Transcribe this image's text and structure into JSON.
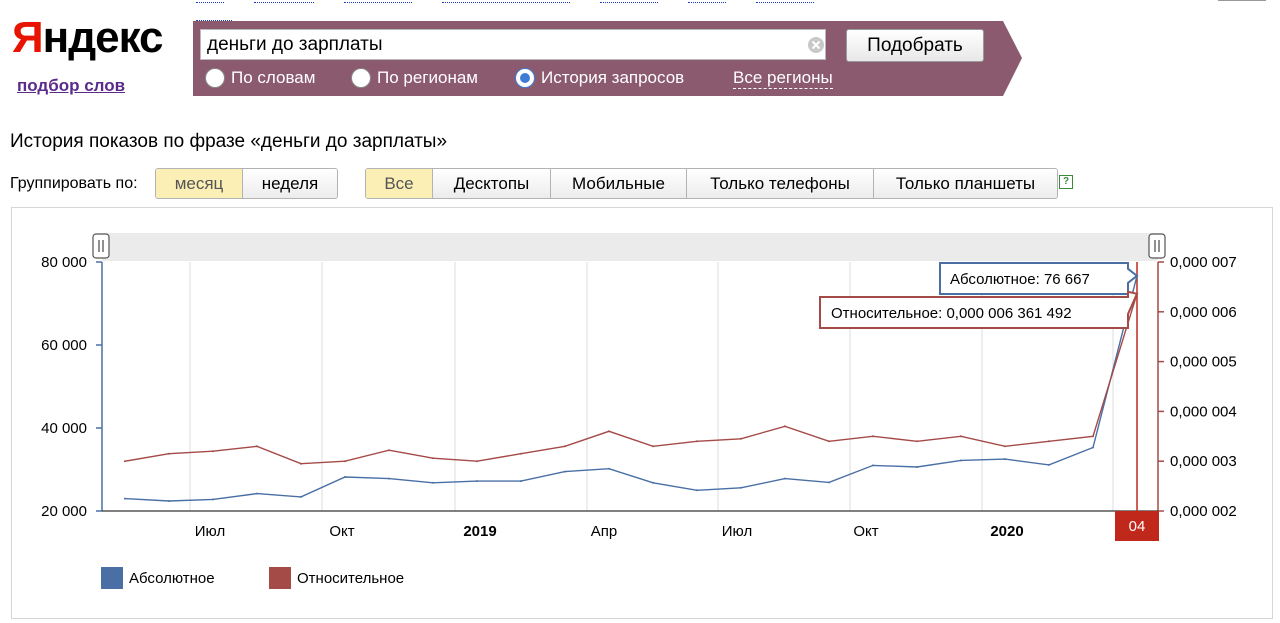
{
  "header": {
    "logo": "Яндекс",
    "logo_first": "Я",
    "logo_rest": "ндекс",
    "subtitle": "подбор слов"
  },
  "search": {
    "query": "деньги до зарплаты",
    "submit_label": "Подобрать",
    "modes": [
      {
        "label": "По словам",
        "selected": false
      },
      {
        "label": "По регионам",
        "selected": false
      },
      {
        "label": "История запросов",
        "selected": true
      }
    ],
    "regions_link": "Все регионы",
    "bar_color": "#8b5a6e"
  },
  "page": {
    "title": "История показов по фразе «деньги до зарплаты»"
  },
  "grouping": {
    "label": "Группировать по:",
    "options": [
      {
        "label": "месяц",
        "active": true
      },
      {
        "label": "неделя",
        "active": false
      }
    ]
  },
  "devices": {
    "options": [
      {
        "label": "Все",
        "active": true
      },
      {
        "label": "Десктопы",
        "active": false
      },
      {
        "label": "Мобильные",
        "active": false
      },
      {
        "label": "Только телефоны",
        "active": false
      },
      {
        "label": "Только планшеты",
        "active": false
      }
    ],
    "help": "?"
  },
  "chart_data": {
    "type": "line",
    "x_ticks": [
      {
        "label": "Июл",
        "bold": false
      },
      {
        "label": "Окт",
        "bold": false
      },
      {
        "label": "2019",
        "bold": true
      },
      {
        "label": "Апр",
        "bold": false
      },
      {
        "label": "Июл",
        "bold": false
      },
      {
        "label": "Окт",
        "bold": false
      },
      {
        "label": "2020",
        "bold": true
      }
    ],
    "y_left": {
      "min": 20000,
      "max": 80000,
      "ticks": [
        "20 000",
        "40 000",
        "60 000",
        "80 000"
      ],
      "tick_values": [
        20000,
        40000,
        60000,
        80000
      ]
    },
    "y_right": {
      "min": 2e-06,
      "max": 7e-06,
      "ticks": [
        "0,000 002",
        "0,000 003",
        "0,000 004",
        "0,000 005",
        "0,000 006",
        "0,000 007"
      ],
      "tick_values": [
        2e-06,
        3e-06,
        4e-06,
        5e-06,
        6e-06,
        7e-06
      ]
    },
    "series": [
      {
        "name": "Абсолютное",
        "axis": "left",
        "color": "#4a6fa5",
        "values": [
          23000,
          22400,
          22800,
          24200,
          23400,
          28200,
          27800,
          26800,
          27200,
          27200,
          29500,
          30200,
          26800,
          25000,
          25600,
          27800,
          26900,
          31000,
          30600,
          32200,
          32500,
          31100,
          35300,
          76667
        ]
      },
      {
        "name": "Относительное",
        "axis": "right",
        "color": "#a44a47",
        "values": [
          3e-06,
          3.15e-06,
          3.2e-06,
          3.3e-06,
          2.95e-06,
          3e-06,
          3.22e-06,
          3.06e-06,
          3e-06,
          3.15e-06,
          3.3e-06,
          3.6e-06,
          3.3e-06,
          3.4e-06,
          3.45e-06,
          3.7e-06,
          3.4e-06,
          3.5e-06,
          3.4e-06,
          3.5e-06,
          3.3e-06,
          3.4e-06,
          3.5e-06,
          6.361492e-06
        ]
      }
    ],
    "tooltip_absolute": "Абсолютное: 76 667",
    "tooltip_relative": "Относительное: 0,000 006 361 492",
    "highlight_label": "04",
    "highlight_color": "#c0281c",
    "legend": [
      "Абсолютное",
      "Относительное"
    ],
    "legend_placement": "bottom-left",
    "grid": "vertical"
  }
}
